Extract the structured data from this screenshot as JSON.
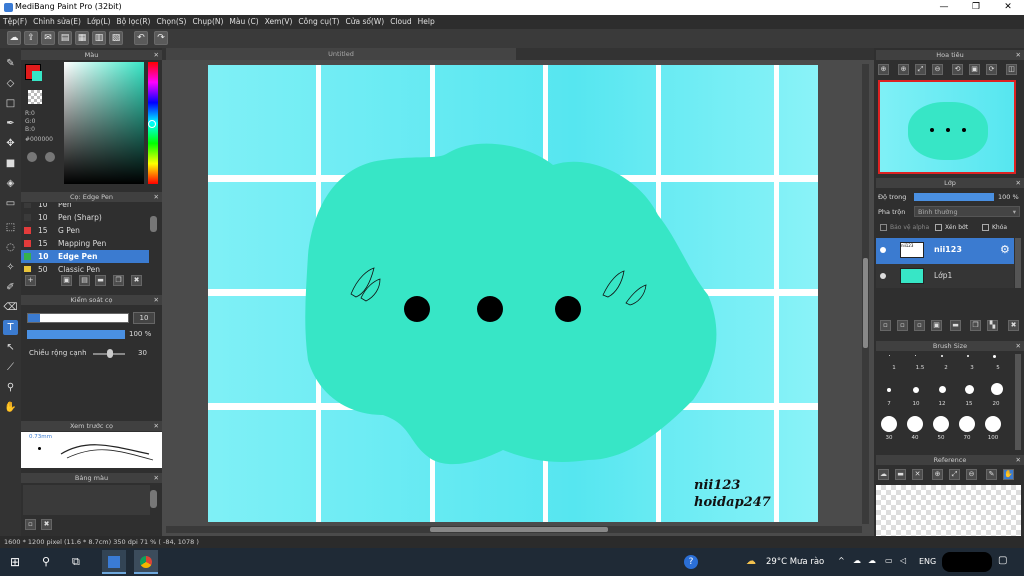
{
  "window": {
    "title": "MediBang Paint Pro (32bit)",
    "minimize": "—",
    "maximize": "❐",
    "close": "✕"
  },
  "menu": [
    "Tệp(F)",
    "Chỉnh sửa(E)",
    "Lớp(L)",
    "Bộ lọc(R)",
    "Chọn(S)",
    "Chụp(N)",
    "Màu (C)",
    "Xem(V)",
    "Công cụ(T)",
    "Cửa số(W)",
    "Cloud",
    "Help"
  ],
  "toolbar": {
    "undo": "↶",
    "redo": "↷"
  },
  "color_panel": {
    "title": "Màu",
    "r": "R:0",
    "g": "G:0",
    "b": "B:0",
    "hex": "#000000"
  },
  "brush_panel": {
    "title": "Cọ: Edge Pen",
    "items": [
      {
        "size": "10",
        "name": "Pen",
        "color": "#3a3a3a"
      },
      {
        "size": "10",
        "name": "Pen (Sharp)",
        "color": "#3a3a3a"
      },
      {
        "size": "15",
        "name": "G Pen",
        "color": "#e23b3b"
      },
      {
        "size": "15",
        "name": "Mapping Pen",
        "color": "#e23b3b"
      },
      {
        "size": "10",
        "name": "Edge Pen",
        "color": "#36b14a"
      },
      {
        "size": "50",
        "name": "Classic Pen",
        "color": "#e8c43a"
      }
    ]
  },
  "brush_control": {
    "title": "Kiểm soát cọ",
    "size_value": "10",
    "size_fraction": 0.12,
    "opacity_value": "100 %",
    "opacity_fraction": 1.0,
    "edge_label": "Chiều rộng cạnh",
    "edge_value": "30"
  },
  "preview": {
    "title": "Xem trước cọ",
    "size_text": "0.73mm"
  },
  "palette": {
    "title": "Bảng màu"
  },
  "document": {
    "tab": "Untitled",
    "signature_line1": "nii123",
    "signature_line2": "hoidap247"
  },
  "navigator": {
    "title": "Hoa tiêu"
  },
  "layer_panel": {
    "title": "Lớp",
    "opacity_label": "Độ trong",
    "opacity_value": "100 %",
    "opacity_fraction": 1.0,
    "blend_label": "Pha trộn",
    "blend_value": "Bình thường",
    "alpha_label": "Bảo vệ alpha",
    "clip_label": "Xén bớt",
    "lock_label": "Khóa",
    "layers": [
      {
        "name": "nii123",
        "selected": true
      },
      {
        "name": "Lớp1",
        "selected": false
      }
    ]
  },
  "brush_size_panel": {
    "title": "Brush Size",
    "row1": [
      "1",
      "1.5",
      "2",
      "3",
      "5"
    ],
    "row2": [
      "7",
      "10",
      "12",
      "15",
      "20"
    ],
    "row3": [
      "30",
      "40",
      "50",
      "70",
      "100"
    ]
  },
  "reference_panel": {
    "title": "Reference"
  },
  "status": {
    "text": "1600 * 1200 pixel   (11.6 * 8.7cm)   350 dpi   71 %   ( -84, 1078 )"
  },
  "taskbar": {
    "weather": "29°C  Mưa rào",
    "lang": "ENG"
  },
  "colors": {
    "accent": "#3b7bd0",
    "blob": "#37e6c6",
    "sky": "#5fe8f2"
  }
}
